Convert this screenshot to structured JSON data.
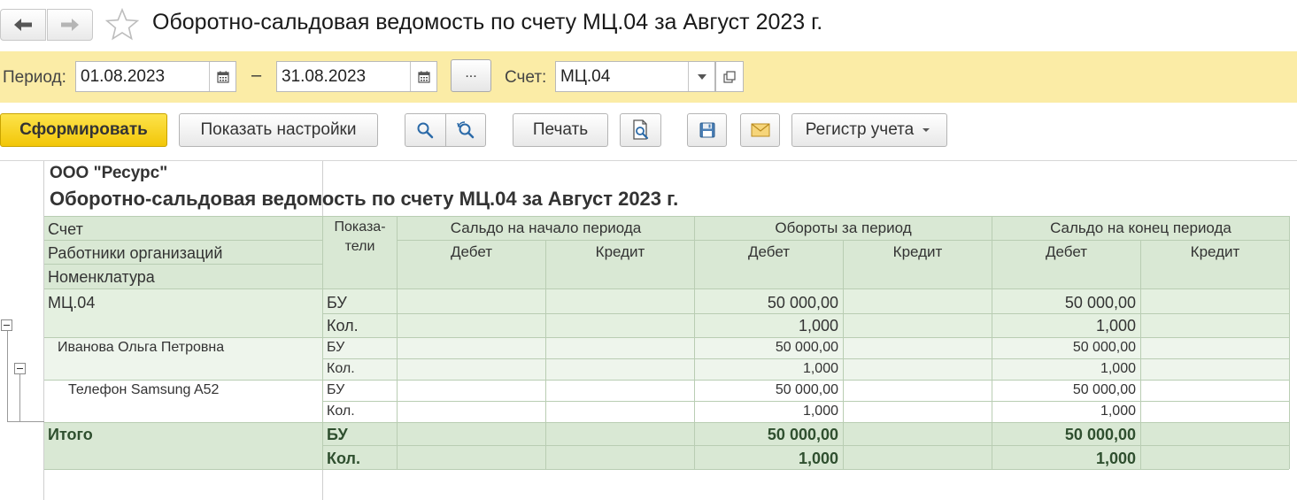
{
  "window": {
    "title": "Оборотно-сальдовая ведомость по счету МЦ.04 за Август 2023 г."
  },
  "period_bar": {
    "period_label": "Период:",
    "date_from": "01.08.2023",
    "dash": "–",
    "date_to": "31.08.2023",
    "dots_label": "...",
    "account_label": "Счет:",
    "account_value": "МЦ.04"
  },
  "toolbar": {
    "generate_label": "Сформировать",
    "show_settings_label": "Показать настройки",
    "print_label": "Печать",
    "register_label": "Регистр учета"
  },
  "report": {
    "organization": "ООО \"Ресурс\"",
    "title": "Оборотно-сальдовая ведомость по счету МЦ.04 за Август 2023 г.",
    "headers": {
      "account": "Счет",
      "employees": "Работники организаций",
      "nomenclature": "Номенклатура",
      "indicators_line1": "Показа-",
      "indicators_line2": "тели",
      "opening_balance": "Сальдо на начало периода",
      "turnover": "Обороты за период",
      "closing_balance": "Сальдо на конец периода",
      "debit": "Дебет",
      "credit": "Кредит"
    },
    "rows": [
      {
        "name": "МЦ.04",
        "indicator": "БУ",
        "turnover_debit": "50 000,00",
        "closing_debit": "50 000,00"
      },
      {
        "name": "",
        "indicator": "Кол.",
        "turnover_debit": "1,000",
        "closing_debit": "1,000"
      },
      {
        "name": "Иванова Ольга Петровна",
        "indicator": "БУ",
        "turnover_debit": "50 000,00",
        "closing_debit": "50 000,00"
      },
      {
        "name": "",
        "indicator": "Кол.",
        "turnover_debit": "1,000",
        "closing_debit": "1,000"
      },
      {
        "name": "Телефон Samsung A52",
        "indicator": "БУ",
        "turnover_debit": "50 000,00",
        "closing_debit": "50 000,00"
      },
      {
        "name": "",
        "indicator": "Кол.",
        "turnover_debit": "1,000",
        "closing_debit": "1,000"
      }
    ],
    "totals": {
      "label": "Итого",
      "rows": [
        {
          "indicator": "БУ",
          "turnover_debit": "50 000,00",
          "closing_debit": "50 000,00"
        },
        {
          "indicator": "Кол.",
          "turnover_debit": "1,000",
          "closing_debit": "1,000"
        }
      ]
    }
  },
  "icons": {
    "back": "arrow-left-icon",
    "forward": "arrow-right-icon",
    "favorite": "star-icon",
    "calendar": "calendar-icon",
    "dropdown": "chevron-down-icon",
    "open": "open-icon",
    "find": "search-icon",
    "find_next": "search-next-icon",
    "preview": "print-preview-icon",
    "save": "floppy-disk-icon",
    "email": "envelope-icon",
    "collapse": "minus-icon"
  },
  "colors": {
    "period_bar": "#fbeca6",
    "primary_button": "#f5cd1a",
    "header_fill": "#d9e8d4",
    "level1_fill": "#e4f0e0",
    "level2_fill": "#eef5ec",
    "totals_fill": "#d9e8d4",
    "totals_text": "#2f4f2f"
  }
}
